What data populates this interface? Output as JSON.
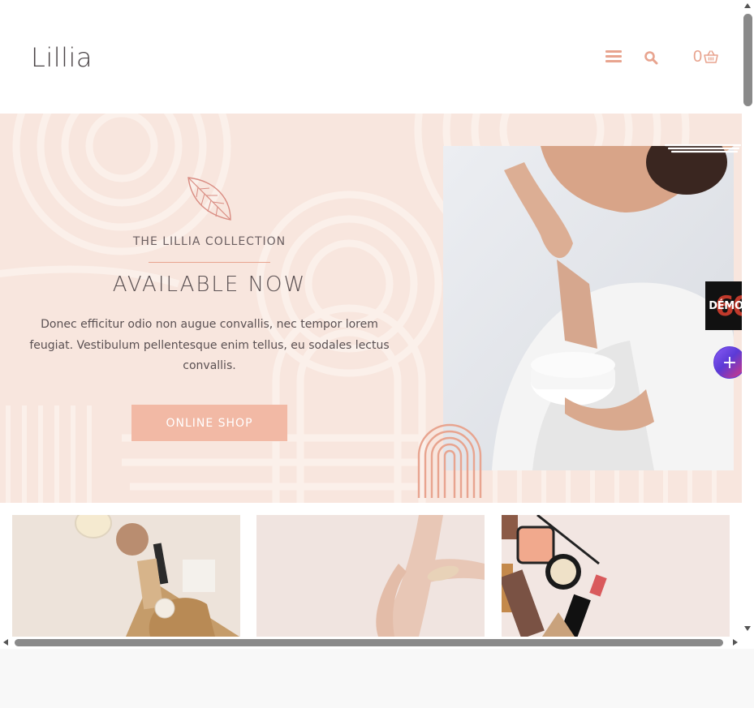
{
  "header": {
    "logo": "Lillia",
    "cart_count": "0",
    "icons": {
      "menu": "hamburger-menu-icon",
      "search": "search-icon",
      "cart": "shopping-basket-icon"
    }
  },
  "hero": {
    "collection_label": "THE LILLIA COLLECTION",
    "headline": "AVAILABLE NOW",
    "description": "Donec efficitur odio non augue convallis, nec tempor lorem feugiat.  Vestibulum pellentesque enim tellus, eu sodales lectus convallis.",
    "cta_label": "ONLINE SHOP",
    "icons": {
      "leaf": "leaf-icon",
      "arch": "rainbow-arch-icon"
    }
  },
  "floating": {
    "demos_label": "DÉMOS",
    "demos_badge_number": "60",
    "plus_label": "+"
  },
  "colors": {
    "accent": "#e8a48f",
    "button": "#f2b9a5",
    "hero_bg": "#f8e6de",
    "text": "#5a5052"
  }
}
